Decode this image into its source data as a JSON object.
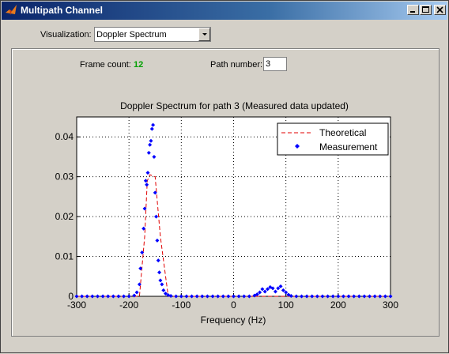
{
  "window": {
    "title": "Multipath Channel",
    "buttons": [
      "minimize",
      "maximize",
      "close"
    ]
  },
  "controls": {
    "visualization_label": "Visualization:",
    "visualization_value": "Doppler Spectrum",
    "frame_count_label": "Frame count:",
    "frame_count_value": "12",
    "path_number_label": "Path number:",
    "path_number_value": "3"
  },
  "colors": {
    "title_bar": "#0a246a",
    "frame_count": "#00a000",
    "theoretical": "#e00000",
    "measurement": "#0000ff"
  },
  "chart_data": {
    "type": "line",
    "title": "Doppler Spectrum for path 3 (Measured data updated)",
    "xlabel": "Frequency (Hz)",
    "ylabel": "",
    "xlim": [
      -300,
      300
    ],
    "ylim": [
      0,
      0.045
    ],
    "x_ticks": [
      "-300",
      "-200",
      "-100",
      "0",
      "100",
      "200",
      "300"
    ],
    "y_ticks": [
      "0",
      "0.01",
      "0.02",
      "0.03",
      "0.04"
    ],
    "grid": true,
    "legend_position": "top-right",
    "series": [
      {
        "name": "Theoretical",
        "style": "dashed",
        "x": [
          -300,
          -200,
          -180,
          -170,
          -165,
          -160,
          -150,
          -140,
          -125,
          -100,
          300
        ],
        "y": [
          0,
          0,
          0,
          0.015,
          0.029,
          0.0305,
          0.03,
          0.015,
          0,
          0,
          0
        ]
      },
      {
        "name": "Measurement",
        "style": "markers",
        "x": [
          -300,
          -290,
          -280,
          -270,
          -260,
          -250,
          -240,
          -230,
          -220,
          -210,
          -200,
          -190,
          -185,
          -180,
          -178,
          -175,
          -172,
          -170,
          -168,
          -166,
          -164,
          -162,
          -160,
          -158,
          -156,
          -154,
          -152,
          -150,
          -148,
          -146,
          -144,
          -142,
          -140,
          -137,
          -134,
          -130,
          -125,
          -120,
          -110,
          -100,
          -90,
          -80,
          -70,
          -60,
          -50,
          -40,
          -30,
          -20,
          -10,
          0,
          10,
          20,
          30,
          40,
          45,
          50,
          55,
          60,
          65,
          70,
          75,
          80,
          85,
          90,
          95,
          100,
          105,
          110,
          120,
          130,
          140,
          150,
          160,
          170,
          180,
          190,
          200,
          210,
          220,
          230,
          240,
          250,
          260,
          270,
          280,
          290,
          300
        ],
        "y": [
          0,
          0,
          0,
          0,
          0,
          0,
          0,
          0,
          0,
          0,
          0,
          0.0002,
          0.001,
          0.003,
          0.007,
          0.011,
          0.017,
          0.022,
          0.029,
          0.028,
          0.031,
          0.036,
          0.038,
          0.039,
          0.042,
          0.043,
          0.035,
          0.026,
          0.02,
          0.014,
          0.009,
          0.006,
          0.004,
          0.003,
          0.0015,
          0.0007,
          0.0003,
          0.0001,
          0,
          0,
          0,
          0,
          0,
          0,
          0,
          0,
          0,
          0,
          0,
          0,
          0,
          0,
          0,
          0.0002,
          0.0005,
          0.001,
          0.0018,
          0.0012,
          0.0018,
          0.0023,
          0.002,
          0.0012,
          0.002,
          0.0025,
          0.0015,
          0.001,
          0.0004,
          0.0001,
          0,
          0,
          0,
          0,
          0,
          0,
          0,
          0,
          0,
          0,
          0,
          0,
          0,
          0,
          0,
          0,
          0,
          0,
          0
        ]
      }
    ]
  }
}
